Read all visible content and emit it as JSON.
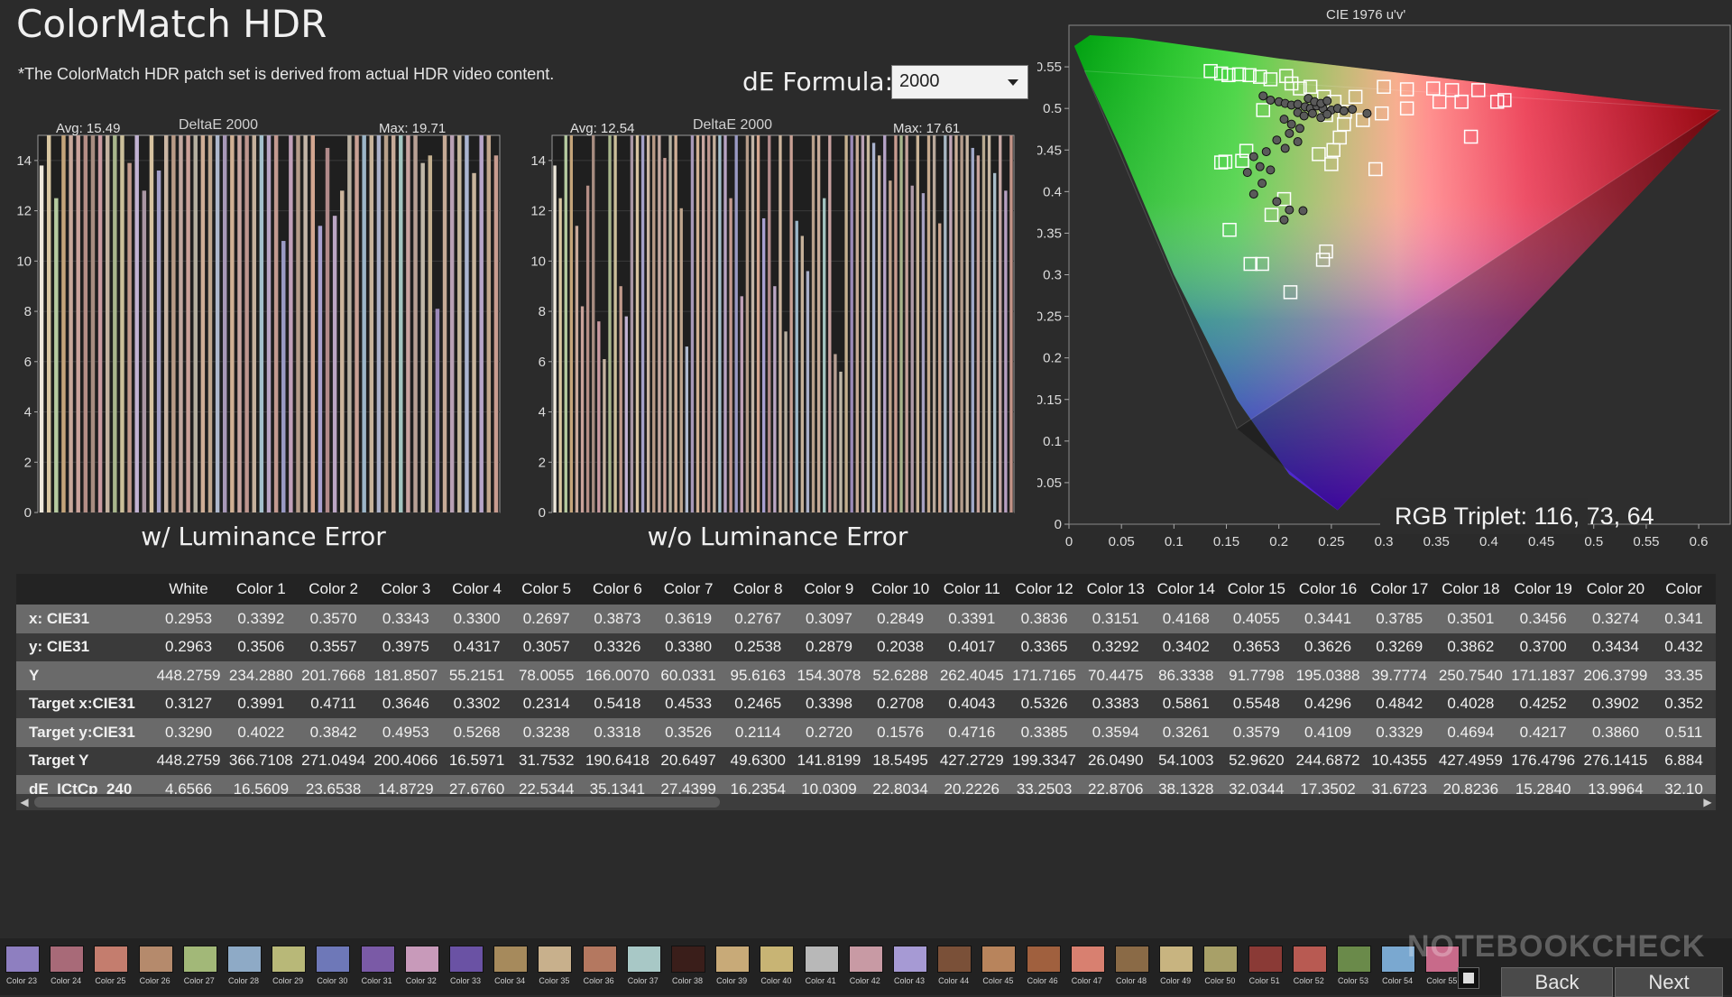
{
  "app": {
    "title": "ColorMatch HDR",
    "note": "*The ColorMatch HDR patch set is derived from actual HDR video content.",
    "formula_label": "dE Formula:",
    "formula_value": "2000",
    "watermark": "NOTEBOOKCHECK"
  },
  "chart_data": [
    {
      "type": "bar",
      "title": "DeltaE 2000",
      "caption": "w/ Luminance Error",
      "avg_label": "Avg: 15.49",
      "max_label": "Max: 19.71",
      "ylim": [
        0,
        15
      ],
      "yticks": [
        0,
        2,
        4,
        6,
        8,
        10,
        12,
        14
      ],
      "values": [
        13.8,
        15,
        12.5,
        15,
        15,
        15,
        15,
        15,
        15,
        15,
        15,
        15,
        13.9,
        15,
        12.8,
        15,
        13.6,
        15,
        15,
        15,
        15,
        15,
        15,
        15,
        15,
        15,
        15,
        15,
        15,
        15,
        15,
        15,
        15,
        10.8,
        15,
        15,
        15,
        15,
        11.4,
        14.5,
        11.8,
        12.8,
        15,
        15,
        15,
        15,
        15,
        15,
        15,
        15,
        15,
        15,
        13.9,
        14.2,
        8.1,
        15,
        15,
        15,
        15,
        13.5,
        15,
        15,
        14.2
      ],
      "colors": [
        "#eee8dc",
        "#d9c7a2",
        "#b6cba0",
        "#c4a47a",
        "#c8a89a",
        "#caa29a",
        "#b58e86",
        "#a78c80",
        "#c99aa0",
        "#c4b2a0",
        "#a8b68c",
        "#cbbf9a",
        "#c29a8c",
        "#c1b2d2",
        "#a996a4",
        "#d6c2a0",
        "#a4a0c8",
        "#cbb6a4",
        "#b89a86",
        "#c2a8a0",
        "#caa098",
        "#b5b0a0",
        "#cfae96",
        "#bfa68e",
        "#aeb8cc",
        "#a898b8",
        "#d0b094",
        "#c8a6a0",
        "#bd968e",
        "#c4b09c",
        "#a4c0cc",
        "#b8a4c4",
        "#c49a90",
        "#9a9ac4",
        "#c0a0b8",
        "#b49a88",
        "#c2b4a6",
        "#d3a690",
        "#a8a0d0",
        "#b18a8a",
        "#bba6c4",
        "#ccb49c",
        "#b9b0a0",
        "#c8a094",
        "#9cb6c8",
        "#c6b29a",
        "#aab0c8",
        "#b8a08a",
        "#c6aa98",
        "#a4c4c0",
        "#c8a2a0",
        "#b8a094",
        "#c0b8a8",
        "#c4b090",
        "#9c8ab8",
        "#c6aa96",
        "#b8a0b4",
        "#c6b69c",
        "#aab4d0",
        "#c8b49c",
        "#b6a4c8",
        "#c0a48c",
        "#c89c90"
      ]
    },
    {
      "type": "bar",
      "title": "DeltaE 2000",
      "caption": "w/o Luminance Error",
      "avg_label": "Avg: 12.54",
      "max_label": "Max: 17.61",
      "ylim": [
        0,
        15
      ],
      "yticks": [
        0,
        2,
        4,
        6,
        8,
        10,
        12,
        14
      ],
      "values": [
        13.8,
        12.5,
        15,
        15,
        11.4,
        8.2,
        13.0,
        15,
        7.6,
        6.1,
        15,
        15,
        9.0,
        7.8,
        15,
        15,
        15,
        15,
        15,
        15,
        14.1,
        15,
        15,
        12.1,
        6.6,
        15,
        15,
        15,
        15,
        15,
        15,
        15,
        12.5,
        15,
        8.6,
        15,
        15,
        15,
        11.7,
        15,
        9.0,
        15,
        7.2,
        15,
        11.6,
        11.0,
        9.6,
        15,
        15,
        12.5,
        15,
        6.3,
        5.6,
        15,
        15,
        15,
        15,
        15,
        14.7,
        14.2,
        15,
        13.2,
        15,
        15,
        15,
        13.0,
        15,
        12.7,
        15,
        15,
        11.5,
        15,
        15,
        15,
        15,
        15,
        14.5,
        14.2,
        15,
        15,
        13.5,
        15,
        12.8,
        15
      ],
      "colors": [
        "#eee8dc",
        "#d9c7a2",
        "#b6cba0",
        "#c4a47a",
        "#c8a89a",
        "#caa29a",
        "#b58e86",
        "#a78c80",
        "#c99aa0",
        "#c4b2a0",
        "#a8b68c",
        "#cbbf9a",
        "#c29a8c",
        "#c1b2d2",
        "#a996a4",
        "#d6c2a0",
        "#a4a0c8",
        "#cbb6a4",
        "#b89a86",
        "#c2a8a0",
        "#caa098",
        "#b5b0a0",
        "#cfae96",
        "#bfa68e",
        "#aeb8cc",
        "#a898b8",
        "#d0b094",
        "#c8a6a0",
        "#bd968e",
        "#c4b09c",
        "#a4c0cc",
        "#b8a4c4",
        "#c49a90",
        "#9a9ac4",
        "#c0a0b8",
        "#b49a88",
        "#c2b4a6",
        "#d3a690",
        "#a8a0d0",
        "#b18a8a",
        "#bba6c4",
        "#ccb49c",
        "#b9b0a0",
        "#c8a094",
        "#9cb6c8",
        "#c6b29a",
        "#aab0c8",
        "#b8a08a",
        "#c6aa98",
        "#a4c4c0",
        "#c8a2a0",
        "#b8a094",
        "#c0b8a8",
        "#c4b090",
        "#9c8ab8",
        "#c6aa96",
        "#b8a0b4",
        "#c6b69c",
        "#aab4d0",
        "#c8b49c",
        "#b6a4c8",
        "#c0a48c",
        "#c89c90",
        "#a8b48c",
        "#c4a29a",
        "#b09aa8",
        "#c8b296",
        "#a6a0c0",
        "#c6aa8e",
        "#b8a89a",
        "#caa48e",
        "#a8b8c4",
        "#c2a6b6",
        "#ccb098",
        "#b49c8c",
        "#c6b4a0",
        "#a0a8c8",
        "#c8a49c",
        "#b6a890",
        "#c4b4a0",
        "#a8bcc8",
        "#c6a8a4",
        "#b8a0c2",
        "#c49488"
      ]
    },
    {
      "type": "scatter",
      "title": "CIE 1976 u'v'",
      "xticks": [
        0,
        0.05,
        0.1,
        0.15,
        0.2,
        0.25,
        0.3,
        0.35,
        0.4,
        0.45,
        0.5,
        0.55,
        0.6
      ],
      "yticks": [
        0,
        0.05,
        0.1,
        0.15,
        0.2,
        0.25,
        0.3,
        0.35,
        0.4,
        0.45,
        0.5,
        0.55
      ],
      "xlim": [
        0,
        0.63
      ],
      "ylim": [
        0,
        0.6
      ],
      "targets": [
        [
          0.135,
          0.545
        ],
        [
          0.145,
          0.542
        ],
        [
          0.152,
          0.54
        ],
        [
          0.162,
          0.541
        ],
        [
          0.172,
          0.54
        ],
        [
          0.182,
          0.538
        ],
        [
          0.192,
          0.535
        ],
        [
          0.207,
          0.539
        ],
        [
          0.212,
          0.53
        ],
        [
          0.22,
          0.524
        ],
        [
          0.23,
          0.526
        ],
        [
          0.243,
          0.514
        ],
        [
          0.253,
          0.508
        ],
        [
          0.273,
          0.514
        ],
        [
          0.3,
          0.526
        ],
        [
          0.322,
          0.523
        ],
        [
          0.347,
          0.524
        ],
        [
          0.365,
          0.522
        ],
        [
          0.39,
          0.522
        ],
        [
          0.415,
          0.51
        ],
        [
          0.263,
          0.496
        ],
        [
          0.298,
          0.494
        ],
        [
          0.322,
          0.5
        ],
        [
          0.353,
          0.508
        ],
        [
          0.374,
          0.508
        ],
        [
          0.408,
          0.508
        ],
        [
          0.185,
          0.498
        ],
        [
          0.245,
          0.492
        ],
        [
          0.262,
          0.481
        ],
        [
          0.28,
          0.486
        ],
        [
          0.258,
          0.465
        ],
        [
          0.238,
          0.445
        ],
        [
          0.169,
          0.449
        ],
        [
          0.149,
          0.436
        ],
        [
          0.145,
          0.435
        ],
        [
          0.25,
          0.433
        ],
        [
          0.292,
          0.427
        ],
        [
          0.383,
          0.466
        ],
        [
          0.205,
          0.391
        ],
        [
          0.193,
          0.372
        ],
        [
          0.153,
          0.354
        ],
        [
          0.245,
          0.328
        ],
        [
          0.242,
          0.318
        ],
        [
          0.184,
          0.313
        ],
        [
          0.173,
          0.313
        ],
        [
          0.211,
          0.279
        ],
        [
          0.165,
          0.437
        ],
        [
          0.252,
          0.45
        ]
      ],
      "measured": [
        [
          0.185,
          0.515
        ],
        [
          0.192,
          0.51
        ],
        [
          0.2,
          0.508
        ],
        [
          0.206,
          0.506
        ],
        [
          0.212,
          0.504
        ],
        [
          0.218,
          0.505
        ],
        [
          0.225,
          0.502
        ],
        [
          0.23,
          0.5
        ],
        [
          0.236,
          0.503
        ],
        [
          0.242,
          0.5
        ],
        [
          0.25,
          0.498
        ],
        [
          0.256,
          0.5
        ],
        [
          0.262,
          0.497
        ],
        [
          0.27,
          0.499
        ],
        [
          0.218,
          0.495
        ],
        [
          0.224,
          0.491
        ],
        [
          0.232,
          0.494
        ],
        [
          0.24,
          0.489
        ],
        [
          0.246,
          0.493
        ],
        [
          0.205,
          0.487
        ],
        [
          0.212,
          0.481
        ],
        [
          0.22,
          0.476
        ],
        [
          0.21,
          0.47
        ],
        [
          0.198,
          0.462
        ],
        [
          0.218,
          0.46
        ],
        [
          0.206,
          0.452
        ],
        [
          0.188,
          0.448
        ],
        [
          0.176,
          0.442
        ],
        [
          0.182,
          0.43
        ],
        [
          0.192,
          0.426
        ],
        [
          0.17,
          0.423
        ],
        [
          0.184,
          0.41
        ],
        [
          0.176,
          0.397
        ],
        [
          0.198,
          0.388
        ],
        [
          0.21,
          0.378
        ],
        [
          0.205,
          0.366
        ],
        [
          0.223,
          0.377
        ],
        [
          0.284,
          0.494
        ],
        [
          0.228,
          0.512
        ],
        [
          0.234,
          0.508
        ],
        [
          0.24,
          0.506
        ],
        [
          0.246,
          0.509
        ]
      ],
      "rgb_triplet": "RGB Triplet: 116, 73, 64"
    }
  ],
  "table": {
    "headers": [
      "",
      "White",
      "Color 1",
      "Color 2",
      "Color 3",
      "Color 4",
      "Color 5",
      "Color 6",
      "Color 7",
      "Color 8",
      "Color 9",
      "Color 10",
      "Color 11",
      "Color 12",
      "Color 13",
      "Color 14",
      "Color 15",
      "Color 16",
      "Color 17",
      "Color 18",
      "Color 19",
      "Color 20",
      "Color"
    ],
    "rows": [
      [
        "x: CIE31",
        "0.2953",
        "0.3392",
        "0.3570",
        "0.3343",
        "0.3300",
        "0.2697",
        "0.3873",
        "0.3619",
        "0.2767",
        "0.3097",
        "0.2849",
        "0.3391",
        "0.3836",
        "0.3151",
        "0.4168",
        "0.4055",
        "0.3441",
        "0.3785",
        "0.3501",
        "0.3456",
        "0.3274",
        "0.341"
      ],
      [
        "y: CIE31",
        "0.2963",
        "0.3506",
        "0.3557",
        "0.3975",
        "0.4317",
        "0.3057",
        "0.3326",
        "0.3380",
        "0.2538",
        "0.2879",
        "0.2038",
        "0.4017",
        "0.3365",
        "0.3292",
        "0.3402",
        "0.3653",
        "0.3626",
        "0.3269",
        "0.3862",
        "0.3700",
        "0.3434",
        "0.432"
      ],
      [
        "Y",
        "448.2759",
        "234.2880",
        "201.7668",
        "181.8507",
        "55.2151",
        "78.0055",
        "166.0070",
        "60.0331",
        "95.6163",
        "154.3078",
        "52.6288",
        "262.4045",
        "171.7165",
        "70.4475",
        "86.3338",
        "91.7798",
        "195.0388",
        "39.7774",
        "250.7540",
        "171.1837",
        "206.3799",
        "33.35"
      ],
      [
        "Target x:CIE31",
        "0.3127",
        "0.3991",
        "0.4711",
        "0.3646",
        "0.3302",
        "0.2314",
        "0.5418",
        "0.4533",
        "0.2465",
        "0.3398",
        "0.2708",
        "0.4043",
        "0.5326",
        "0.3383",
        "0.5861",
        "0.5548",
        "0.4296",
        "0.4842",
        "0.4028",
        "0.4252",
        "0.3902",
        "0.352"
      ],
      [
        "Target y:CIE31",
        "0.3290",
        "0.4022",
        "0.3842",
        "0.4953",
        "0.5268",
        "0.3238",
        "0.3318",
        "0.3526",
        "0.2114",
        "0.2720",
        "0.1576",
        "0.4716",
        "0.3385",
        "0.3594",
        "0.3261",
        "0.3579",
        "0.4109",
        "0.3329",
        "0.4694",
        "0.4217",
        "0.3860",
        "0.511"
      ],
      [
        "Target Y",
        "448.2759",
        "366.7108",
        "271.0494",
        "200.4066",
        "16.5971",
        "31.7532",
        "190.6418",
        "20.6497",
        "49.6300",
        "141.8199",
        "18.5495",
        "427.2729",
        "199.3347",
        "26.0490",
        "54.1003",
        "52.9620",
        "244.6872",
        "10.4355",
        "427.4959",
        "176.4796",
        "276.1415",
        "6.884"
      ],
      [
        "dE_ICtCp_240",
        "4.6566",
        "16.5609",
        "23.6538",
        "14.8729",
        "27.6760",
        "22.5344",
        "35.1341",
        "27.4399",
        "16.2354",
        "10.0309",
        "22.8034",
        "20.2226",
        "33.2503",
        "22.8706",
        "38.1328",
        "32.0344",
        "17.3502",
        "31.6723",
        "20.8236",
        "15.2840",
        "13.9964",
        "32.10"
      ]
    ]
  },
  "swatches": [
    {
      "label": "Color 23",
      "color": "#8e7fc0"
    },
    {
      "label": "Color 24",
      "color": "#a86a78"
    },
    {
      "label": "Color 25",
      "color": "#c47d6e"
    },
    {
      "label": "Color 26",
      "color": "#b58a6c"
    },
    {
      "label": "Color 27",
      "color": "#a2b878"
    },
    {
      "label": "Color 28",
      "color": "#8eaac6"
    },
    {
      "label": "Color 29",
      "color": "#b8b878"
    },
    {
      "label": "Color 30",
      "color": "#6e78b8"
    },
    {
      "label": "Color 31",
      "color": "#7a5aa6"
    },
    {
      "label": "Color 32",
      "color": "#c89aba"
    },
    {
      "label": "Color 33",
      "color": "#6a52a4"
    },
    {
      "label": "Color 34",
      "color": "#a68a5c"
    },
    {
      "label": "Color 35",
      "color": "#c8b08c"
    },
    {
      "label": "Color 36",
      "color": "#b47860"
    },
    {
      "label": "Color 37",
      "color": "#a8c8c6"
    },
    {
      "label": "Color 38",
      "color": "#3a1e1a"
    },
    {
      "label": "Color 39",
      "color": "#c8aa78"
    },
    {
      "label": "Color 40",
      "color": "#c8b474"
    },
    {
      "label": "Color 41",
      "color": "#b8b8b8"
    },
    {
      "label": "Color 42",
      "color": "#c89aa4"
    },
    {
      "label": "Color 43",
      "color": "#a69ad4"
    },
    {
      "label": "Color 44",
      "color": "#7a5038"
    },
    {
      "label": "Color 45",
      "color": "#b8845c"
    },
    {
      "label": "Color 46",
      "color": "#a0603e"
    },
    {
      "label": "Color 47",
      "color": "#d88070"
    },
    {
      "label": "Color 48",
      "color": "#8a6a46"
    },
    {
      "label": "Color 49",
      "color": "#c8b480"
    },
    {
      "label": "Color 50",
      "color": "#a8a068"
    },
    {
      "label": "Color 51",
      "color": "#8a3a36"
    },
    {
      "label": "Color 52",
      "color": "#b85a52"
    },
    {
      "label": "Color 53",
      "color": "#6a8a4a"
    },
    {
      "label": "Color 54",
      "color": "#7aa8d0"
    },
    {
      "label": "Color 55",
      "color": "#c86a8a"
    }
  ],
  "nav": {
    "back": "Back",
    "next": "Next"
  }
}
